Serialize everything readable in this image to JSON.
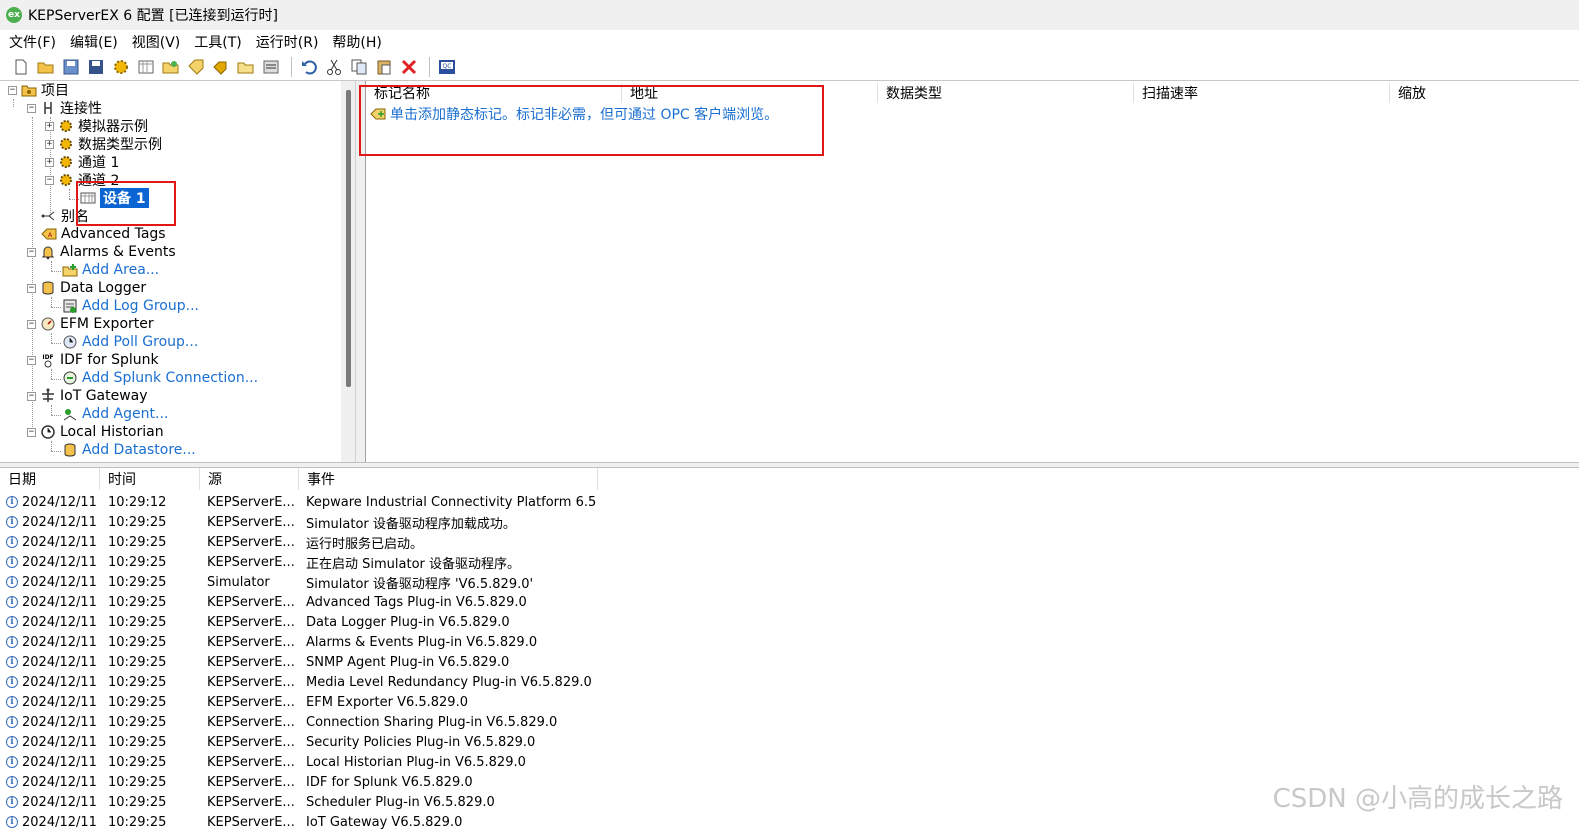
{
  "window": {
    "title": "KEPServerEX 6 配置 [已连接到运行时]",
    "app_icon": "ex"
  },
  "menu": [
    "文件(F)",
    "编辑(E)",
    "视图(V)",
    "工具(T)",
    "运行时(R)",
    "帮助(H)"
  ],
  "toolbar": [
    "new-icon",
    "open-icon",
    "save-icon",
    "save-as-icon",
    "new-channel-icon",
    "new-device-icon",
    "new-tag-group-icon",
    "new-tag-icon",
    "bulk-tag-icon",
    "new-tag-group-2-icon",
    "properties-icon",
    "undo-icon",
    "cut-icon",
    "copy-icon",
    "paste-icon",
    "delete-icon",
    "quick-client-icon"
  ],
  "tree": {
    "root": "项目",
    "connectivity": "连接性",
    "sim_example": "模拟器示例",
    "datatype_example": "数据类型示例",
    "channel1": "通道 1",
    "channel2": "通道 2",
    "device1": "设备 1",
    "aliases": "别名",
    "advanced_tags": "Advanced Tags",
    "alarms_events": "Alarms & Events",
    "add_area": "Add Area...",
    "data_logger": "Data Logger",
    "add_log_group": "Add Log Group...",
    "efm_exporter": "EFM Exporter",
    "add_poll_group": "Add Poll Group...",
    "idf_splunk": "IDF for Splunk",
    "add_splunk": "Add Splunk Connection...",
    "iot_gateway": "IoT Gateway",
    "add_agent": "Add Agent...",
    "local_historian": "Local Historian",
    "add_datastore": "Add Datastore..."
  },
  "detail": {
    "columns": [
      "标记名称",
      "地址",
      "数据类型",
      "扫描速率",
      "缩放"
    ],
    "hint": "单击添加静态标记。标记非必需，但可通过 OPC 客户端浏览。"
  },
  "log": {
    "columns": [
      "日期",
      "时间",
      "源",
      "事件"
    ],
    "rows": [
      {
        "date": "2024/12/11",
        "time": "10:29:12",
        "source": "KEPServerE...",
        "event": "Kepware Industrial Connectivity Platform 6.5"
      },
      {
        "date": "2024/12/11",
        "time": "10:29:25",
        "source": "KEPServerE...",
        "event": "Simulator 设备驱动程序加载成功。"
      },
      {
        "date": "2024/12/11",
        "time": "10:29:25",
        "source": "KEPServerE...",
        "event": "运行时服务已启动。"
      },
      {
        "date": "2024/12/11",
        "time": "10:29:25",
        "source": "KEPServerE...",
        "event": "正在启动 Simulator 设备驱动程序。"
      },
      {
        "date": "2024/12/11",
        "time": "10:29:25",
        "source": "Simulator",
        "event": "Simulator 设备驱动程序 'V6.5.829.0'"
      },
      {
        "date": "2024/12/11",
        "time": "10:29:25",
        "source": "KEPServerE...",
        "event": "Advanced Tags Plug-in V6.5.829.0"
      },
      {
        "date": "2024/12/11",
        "time": "10:29:25",
        "source": "KEPServerE...",
        "event": "Data Logger Plug-in V6.5.829.0"
      },
      {
        "date": "2024/12/11",
        "time": "10:29:25",
        "source": "KEPServerE...",
        "event": "Alarms & Events Plug-in V6.5.829.0"
      },
      {
        "date": "2024/12/11",
        "time": "10:29:25",
        "source": "KEPServerE...",
        "event": "SNMP Agent Plug-in V6.5.829.0"
      },
      {
        "date": "2024/12/11",
        "time": "10:29:25",
        "source": "KEPServerE...",
        "event": "Media Level Redundancy Plug-in V6.5.829.0"
      },
      {
        "date": "2024/12/11",
        "time": "10:29:25",
        "source": "KEPServerE...",
        "event": "EFM Exporter V6.5.829.0"
      },
      {
        "date": "2024/12/11",
        "time": "10:29:25",
        "source": "KEPServerE...",
        "event": "Connection Sharing Plug-in V6.5.829.0"
      },
      {
        "date": "2024/12/11",
        "time": "10:29:25",
        "source": "KEPServerE...",
        "event": "Security Policies Plug-in V6.5.829.0"
      },
      {
        "date": "2024/12/11",
        "time": "10:29:25",
        "source": "KEPServerE...",
        "event": "Local Historian Plug-in V6.5.829.0"
      },
      {
        "date": "2024/12/11",
        "time": "10:29:25",
        "source": "KEPServerE...",
        "event": "IDF for Splunk V6.5.829.0"
      },
      {
        "date": "2024/12/11",
        "time": "10:29:25",
        "source": "KEPServerE...",
        "event": "Scheduler Plug-in V6.5.829.0"
      },
      {
        "date": "2024/12/11",
        "time": "10:29:25",
        "source": "KEPServerE...",
        "event": "IoT Gateway V6.5.829.0"
      }
    ]
  },
  "watermark": "CSDN @小高的成长之路",
  "colors": {
    "selection": "#0a64d2",
    "link": "#1a6fd1",
    "annotation": "#e01818"
  }
}
